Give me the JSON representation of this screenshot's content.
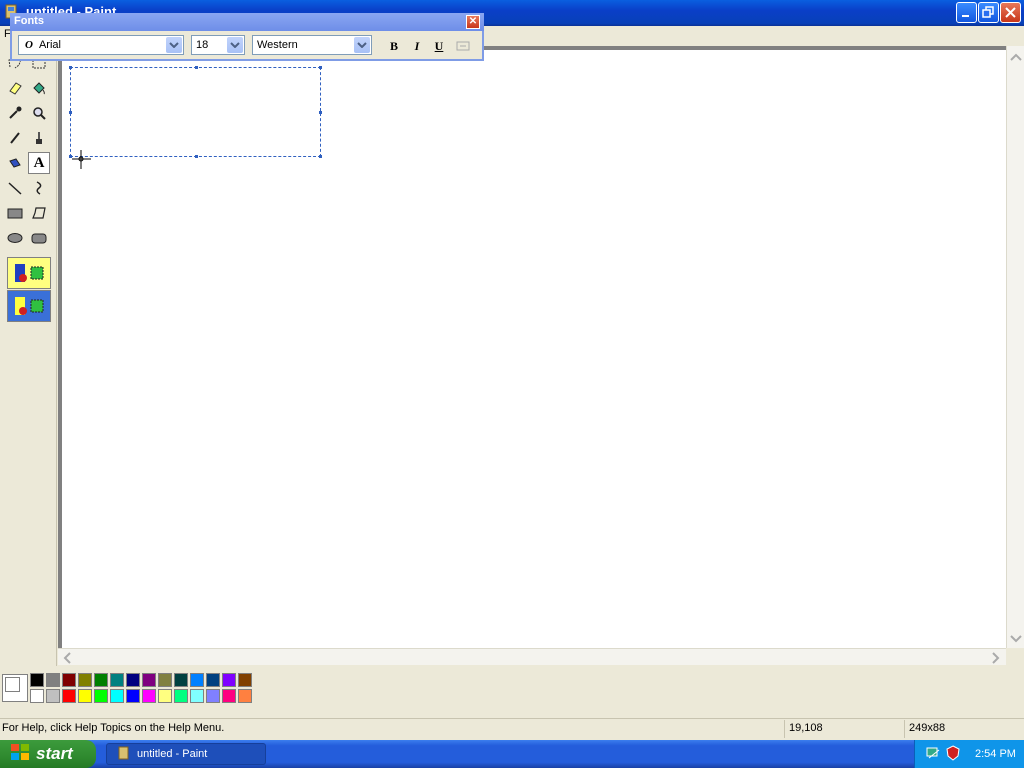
{
  "window": {
    "title": "untitled - Paint"
  },
  "menubar": {
    "items": [
      "F"
    ]
  },
  "toolbox": {
    "tools": [
      {
        "name": "free-form-select",
        "icon": "free-select-icon"
      },
      {
        "name": "select",
        "icon": "rect-select-icon"
      },
      {
        "name": "eraser",
        "icon": "eraser-icon"
      },
      {
        "name": "fill-with-color",
        "icon": "fill-bucket-icon"
      },
      {
        "name": "pick-color",
        "icon": "eyedropper-icon"
      },
      {
        "name": "magnifier",
        "icon": "magnifier-icon"
      },
      {
        "name": "pencil",
        "icon": "pencil-icon"
      },
      {
        "name": "brush",
        "icon": "brush-icon"
      },
      {
        "name": "airbrush",
        "icon": "airbrush-icon"
      },
      {
        "name": "text",
        "icon": "text-icon",
        "label": "A",
        "selected": true
      },
      {
        "name": "line",
        "icon": "line-icon"
      },
      {
        "name": "curve",
        "icon": "curve-icon"
      },
      {
        "name": "rectangle",
        "icon": "rectangle-icon"
      },
      {
        "name": "polygon",
        "icon": "polygon-icon"
      },
      {
        "name": "ellipse",
        "icon": "ellipse-icon"
      },
      {
        "name": "rounded-rectangle",
        "icon": "rounded-rectangle-icon"
      }
    ],
    "options": [
      "opaque-background",
      "transparent-background"
    ]
  },
  "fonts_toolbar": {
    "title": "Fonts",
    "font_name": "Arial",
    "font_size": "18",
    "script": "Western",
    "bold": "B",
    "italic": "I",
    "underline": "U"
  },
  "palette": {
    "top_row": [
      "#000000",
      "#808080",
      "#800000",
      "#808000",
      "#008000",
      "#008080",
      "#000080",
      "#800080",
      "#808040",
      "#004040",
      "#0080ff",
      "#004080",
      "#8000ff",
      "#804000"
    ],
    "bottom_row": [
      "#ffffff",
      "#c0c0c0",
      "#ff0000",
      "#ffff00",
      "#00ff00",
      "#00ffff",
      "#0000ff",
      "#ff00ff",
      "#ffff80",
      "#00ff80",
      "#80ffff",
      "#8080ff",
      "#ff0080",
      "#ff8040"
    ]
  },
  "statusbar": {
    "help": "For Help, click Help Topics on the Help Menu.",
    "coords": "19,108",
    "size": "249x88"
  },
  "taskbar": {
    "start": "start",
    "task": "untitled - Paint",
    "clock": "2:54 PM"
  }
}
